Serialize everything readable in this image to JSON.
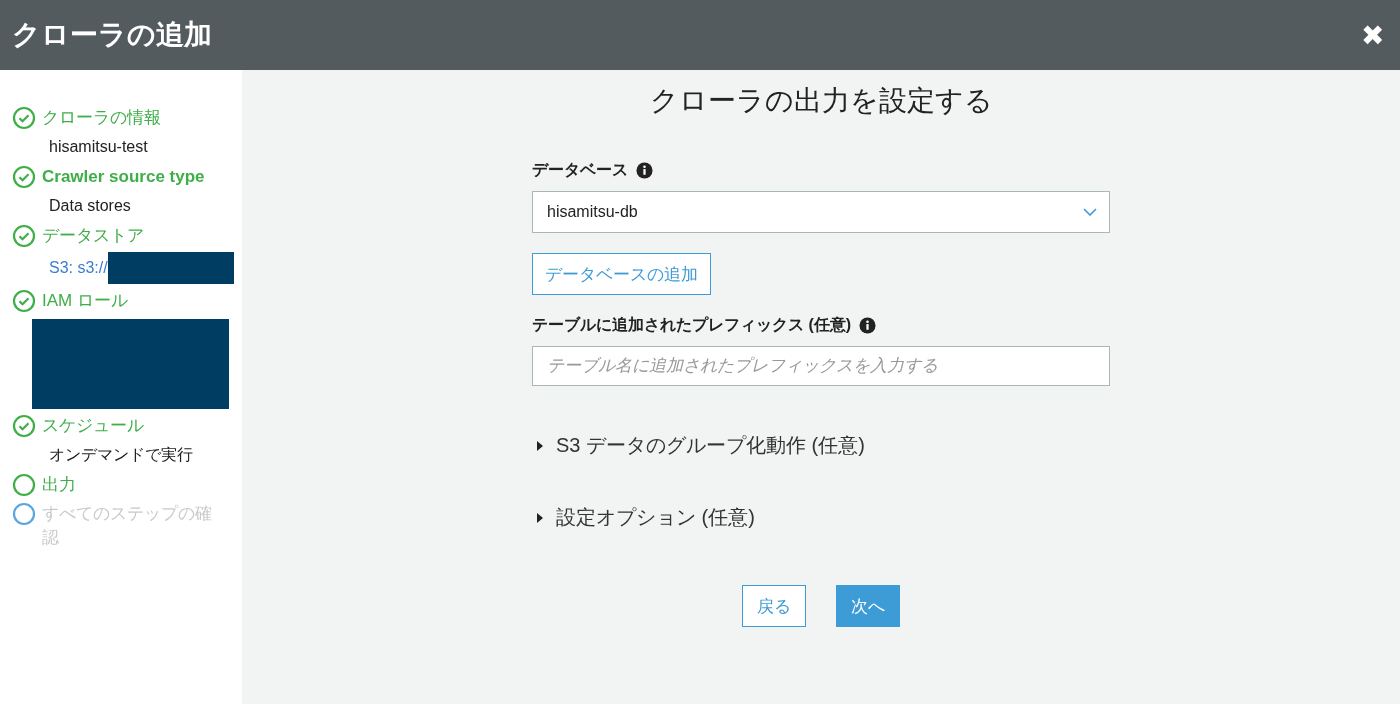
{
  "window": {
    "title": "クローラの追加",
    "close": "✖"
  },
  "steps": [
    {
      "label": "クローラの情報",
      "completed": true,
      "current": false,
      "detail": "hisamitsu-test",
      "detail_link": false
    },
    {
      "label": "Crawler source type",
      "completed": true,
      "current": false,
      "detail": "Data stores",
      "detail_link": false
    },
    {
      "label": "データストア",
      "completed": true,
      "current": false,
      "detail": "S3: s3://",
      "detail_link": true,
      "redacted": true
    },
    {
      "label": "IAM ロール",
      "completed": true,
      "current": false,
      "redacted": true
    },
    {
      "label": "スケジュール",
      "completed": true,
      "current": false,
      "detail": "オンデマンドで実行",
      "detail_link": false
    },
    {
      "label": "出力",
      "completed": false,
      "current": true
    },
    {
      "label": "すべてのステップの確認",
      "completed": false,
      "current": false
    }
  ],
  "form": {
    "heading": "クローラの出力を設定する",
    "database": {
      "label": "データベース",
      "value": "hisamitsu-db"
    },
    "add_database_button": "データベースの追加",
    "prefix": {
      "label": "テーブルに追加されたプレフィックス (任意)",
      "placeholder": "テーブル名に追加されたプレフィックスを入力する"
    },
    "sections": [
      {
        "label": "S3 データのグループ化動作 (任意)",
        "expanded": false
      },
      {
        "label": "設定オプション (任意)",
        "expanded": false
      }
    ],
    "buttons": [
      {
        "label": "戻る",
        "kind": "secondary"
      },
      {
        "label": "次へ",
        "kind": "primary"
      }
    ]
  }
}
